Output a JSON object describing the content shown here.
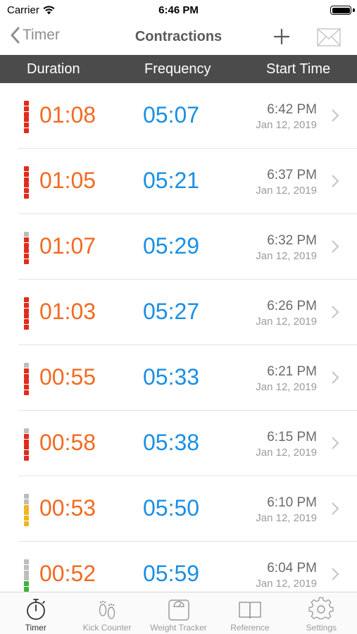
{
  "status_bar": {
    "carrier": "Carrier",
    "time": "6:46 PM"
  },
  "nav": {
    "back_label": "Timer",
    "title": "Contractions",
    "add_icon": "plus-icon",
    "mail_icon": "envelope-icon"
  },
  "columns": {
    "duration": "Duration",
    "frequency": "Frequency",
    "start_time": "Start Time"
  },
  "colors": {
    "duration": "#f26a21",
    "frequency": "#1a8fe3",
    "header_bg": "#4b4b4b",
    "intensity_red": "#e12b1c",
    "intensity_yellow": "#f2b51a",
    "intensity_green": "#3bb43a",
    "intensity_empty": "#bdbdbd"
  },
  "contractions": [
    {
      "duration": "01:08",
      "frequency": "05:07",
      "time": "6:42 PM",
      "date": "Jan 12, 2019",
      "intensity": [
        "red",
        "red",
        "red",
        "red",
        "red",
        "red"
      ]
    },
    {
      "duration": "01:05",
      "frequency": "05:21",
      "time": "6:37 PM",
      "date": "Jan 12, 2019",
      "intensity": [
        "red",
        "red",
        "red",
        "red",
        "red",
        "red"
      ]
    },
    {
      "duration": "01:07",
      "frequency": "05:29",
      "time": "6:32 PM",
      "date": "Jan 12, 2019",
      "intensity": [
        "empty",
        "red",
        "red",
        "red",
        "red",
        "red"
      ]
    },
    {
      "duration": "01:03",
      "frequency": "05:27",
      "time": "6:26 PM",
      "date": "Jan 12, 2019",
      "intensity": [
        "red",
        "red",
        "red",
        "red",
        "red",
        "red"
      ]
    },
    {
      "duration": "00:55",
      "frequency": "05:33",
      "time": "6:21 PM",
      "date": "Jan 12, 2019",
      "intensity": [
        "empty",
        "red",
        "red",
        "red",
        "red",
        "red"
      ]
    },
    {
      "duration": "00:58",
      "frequency": "05:38",
      "time": "6:15 PM",
      "date": "Jan 12, 2019",
      "intensity": [
        "empty",
        "red",
        "red",
        "red",
        "red",
        "red"
      ]
    },
    {
      "duration": "00:53",
      "frequency": "05:50",
      "time": "6:10 PM",
      "date": "Jan 12, 2019",
      "intensity": [
        "empty",
        "empty",
        "yellow",
        "yellow",
        "yellow",
        "yellow"
      ]
    },
    {
      "duration": "00:52",
      "frequency": "05:59",
      "time": "6:04 PM",
      "date": "Jan 12, 2019",
      "intensity": [
        "empty",
        "empty",
        "empty",
        "empty",
        "green",
        "green"
      ]
    }
  ],
  "tabs": [
    {
      "label": "Timer",
      "icon": "stopwatch-icon",
      "active": true
    },
    {
      "label": "Kick Counter",
      "icon": "footprints-icon",
      "active": false
    },
    {
      "label": "Weight Tracker",
      "icon": "scale-icon",
      "active": false
    },
    {
      "label": "Reference",
      "icon": "book-icon",
      "active": false
    },
    {
      "label": "Settings",
      "icon": "gear-icon",
      "active": false
    }
  ]
}
